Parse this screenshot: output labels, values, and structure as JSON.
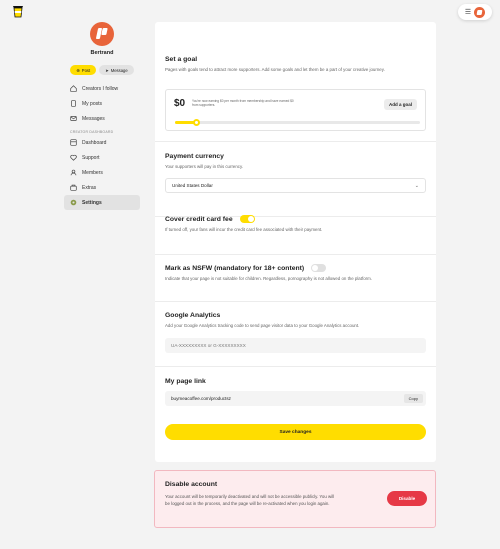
{
  "colors": {
    "accent": "#ffdd00",
    "brand": "#e8643a",
    "danger": "#e63946"
  },
  "sidebar": {
    "user_name": "Bertrand",
    "post_label": "Post",
    "message_label": "Message",
    "items": [
      {
        "label": "Creators I follow",
        "icon": "home-icon"
      },
      {
        "label": "My posts",
        "icon": "document-icon"
      },
      {
        "label": "Messages",
        "icon": "mail-icon"
      }
    ],
    "section_label": "CREATOR DASHBOARD",
    "creator_items": [
      {
        "label": "Dashboard",
        "icon": "dashboard-icon"
      },
      {
        "label": "Support",
        "icon": "heart-icon"
      },
      {
        "label": "Members",
        "icon": "members-icon"
      },
      {
        "label": "Extras",
        "icon": "extras-icon"
      },
      {
        "label": "Settings",
        "icon": "settings-icon"
      }
    ]
  },
  "goal": {
    "title": "Set a goal",
    "description": "Pages with goals tend to attract more supporters. Add some goals and let them be a part of your creative journey.",
    "amount": "$0",
    "earning_text": "You're now earning $0 per month from membership and have earned $0 from supporters.",
    "add_label": "Add a goal",
    "progress": 0.08
  },
  "currency": {
    "title": "Payment currency",
    "description": "Your supporters will pay in this currency.",
    "selected": "United States Dollar"
  },
  "fee": {
    "title": "Cover credit card fee",
    "enabled": true,
    "description": "If turned off, your fans will incur the credit card fee associated with their payment."
  },
  "nsfw": {
    "title": "Mark as NSFW (mandatory for 18+ content)",
    "enabled": false,
    "description": "Indicate that your page is not suitable for children. Regardless, pornography is not allowed on the platform."
  },
  "analytics": {
    "title": "Google Analytics",
    "description": "Add your Google Analytics tracking code to send page visitor data to your Google Analytics account.",
    "placeholder": "UA-XXXXXXXXX or G-XXXXXXXXX"
  },
  "page_link": {
    "title": "My page link",
    "url": "buymeacoffee.com/productsz",
    "copy_label": "Copy"
  },
  "save_label": "Save changes",
  "disable": {
    "title": "Disable account",
    "description": "Your account will be temporarily deactivated and will not be accessible publicly. You will be logged out in the process, and the page will be re-activated when you login again.",
    "button_label": "Disable"
  }
}
